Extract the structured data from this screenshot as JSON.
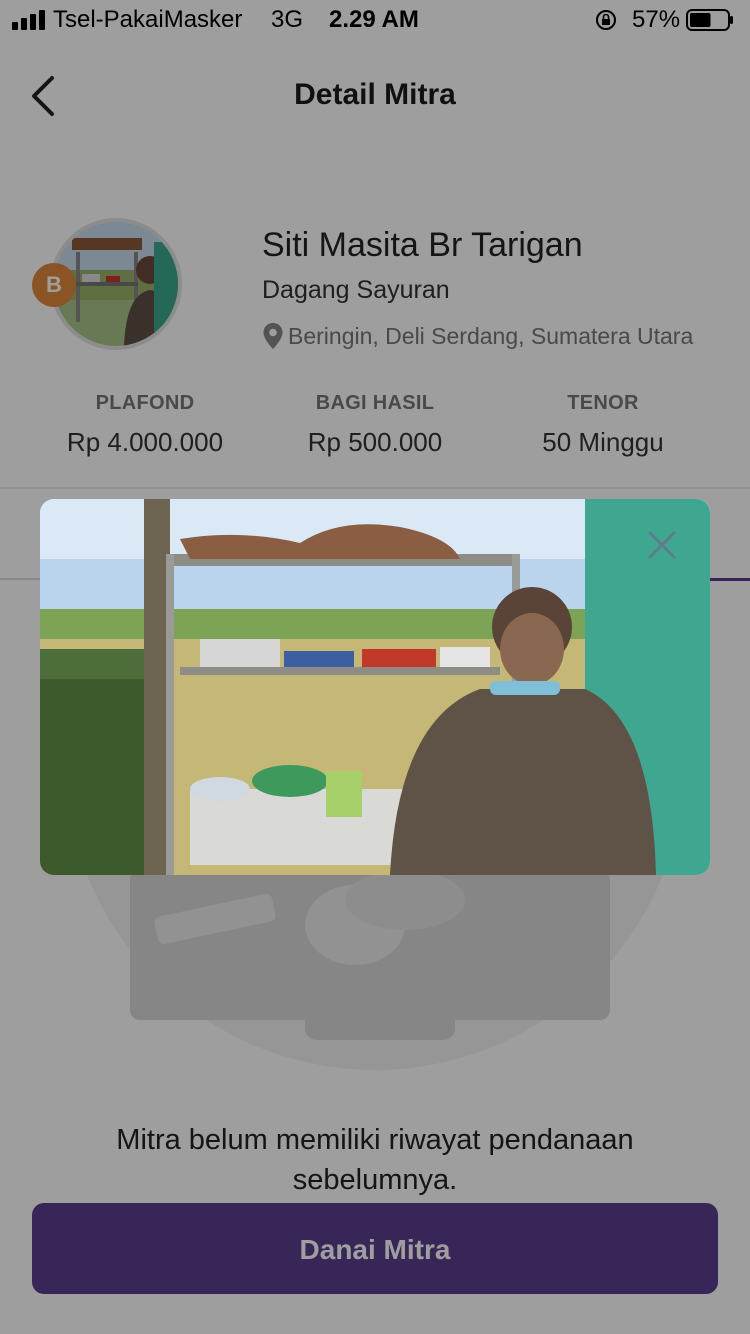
{
  "status_bar": {
    "carrier": "Tsel-PakaiMasker",
    "network": "3G",
    "time": "2.29 AM",
    "battery_percent": "57%",
    "battery_level": 0.57
  },
  "header": {
    "title": "Detail Mitra"
  },
  "profile": {
    "grade_badge": "B",
    "name": "Siti Masita Br Tarigan",
    "business": "Dagang Sayuran",
    "location": "Beringin, Deli Serdang, Sumatera Utara"
  },
  "stats": [
    {
      "label": "PLAFOND",
      "value": "Rp 4.000.000"
    },
    {
      "label": "BAGI HASIL",
      "value": "Rp 500.000"
    },
    {
      "label": "TENOR",
      "value": "50 Minggu"
    }
  ],
  "empty_state": {
    "message": "Mitra belum memiliki riwayat pendanaan sebelumnya."
  },
  "actions": {
    "fund_button": "Danai Mitra"
  },
  "colors": {
    "primary": "#5b3e8e",
    "badge": "#e0883a",
    "overlay": "rgba(0,0,0,0.38)"
  },
  "icons": {
    "back": "chevron-left-icon",
    "close": "close-icon",
    "location": "map-pin-icon"
  }
}
